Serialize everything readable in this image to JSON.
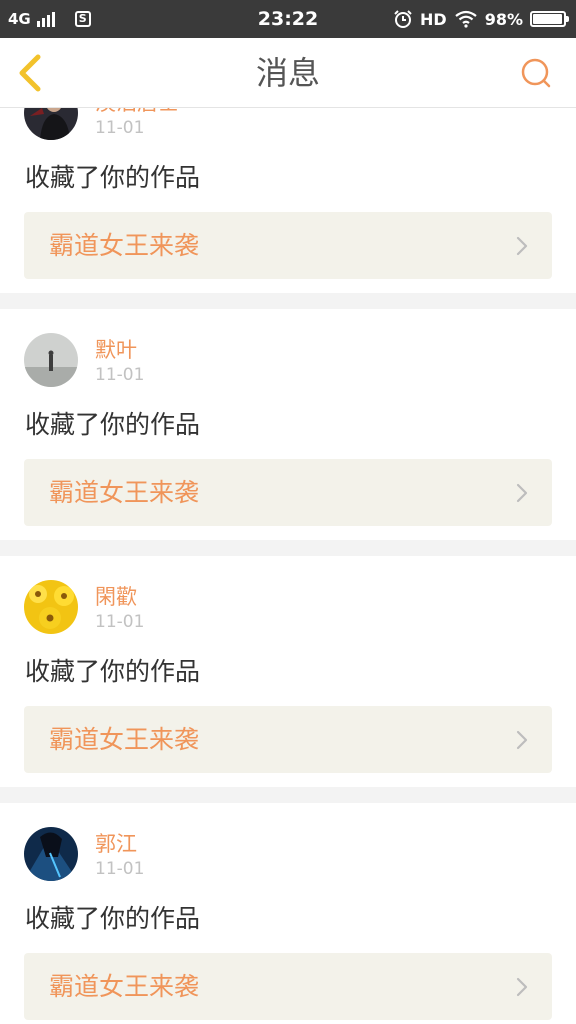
{
  "status_bar": {
    "network": "4G",
    "time": "23:22",
    "hd_label": "HD",
    "battery_percent_label": "98%",
    "battery_level": 0.98
  },
  "nav": {
    "title": "消息",
    "back_icon": "chevron-left-icon",
    "search_icon": "search-icon"
  },
  "colors": {
    "accent": "#f0955a",
    "back_icon": "#f2c22b",
    "work_bg": "#f3f2ea"
  },
  "notifications": [
    {
      "user": "淡泊居士",
      "date": "11-01",
      "action": "收藏了你的作品",
      "work": "霸道女王来袭"
    },
    {
      "user": "默叶",
      "date": "11-01",
      "action": "收藏了你的作品",
      "work": "霸道女王来袭"
    },
    {
      "user": "閑歡",
      "date": "11-01",
      "action": "收藏了你的作品",
      "work": "霸道女王来袭"
    },
    {
      "user": "郭江",
      "date": "11-01",
      "action": "收藏了你的作品",
      "work": "霸道女王来袭"
    }
  ]
}
